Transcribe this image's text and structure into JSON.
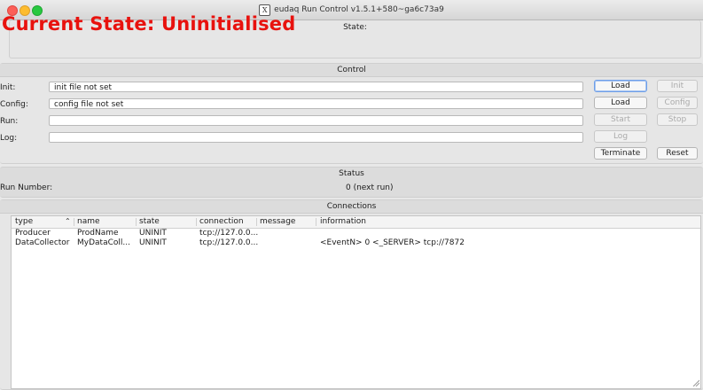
{
  "window": {
    "title": "eudaq Run Control v1.5.1+580~ga6c73a9"
  },
  "state": {
    "header": "State:",
    "current": "Current State: Uninitialised",
    "color": "#e8120e"
  },
  "control": {
    "header": "Control",
    "rows": [
      {
        "label": "Init:",
        "value": "init file not set"
      },
      {
        "label": "Config:",
        "value": "config file not set"
      },
      {
        "label": "Run:",
        "value": ""
      },
      {
        "label": "Log:",
        "value": ""
      }
    ],
    "buttons": {
      "load_init": "Load",
      "init": "Init",
      "load_config": "Load",
      "config": "Config",
      "start": "Start",
      "stop": "Stop",
      "log": "Log",
      "terminate": "Terminate",
      "reset": "Reset"
    }
  },
  "status": {
    "header": "Status",
    "run_number_label": "Run Number:",
    "run_number_value": "0 (next run)"
  },
  "connections": {
    "header": "Connections",
    "columns": [
      "type",
      "name",
      "state",
      "connection",
      "message",
      "information"
    ],
    "rows": [
      {
        "type": "Producer",
        "name": "ProdName",
        "state": "UNINIT",
        "connection": "tcp://127.0.0...",
        "message": "",
        "information": ""
      },
      {
        "type": "DataCollector",
        "name": "MyDataColl...",
        "state": "UNINIT",
        "connection": "tcp://127.0.0...",
        "message": "",
        "information": "<EventN> 0  <_SERVER> tcp://7872"
      }
    ]
  }
}
